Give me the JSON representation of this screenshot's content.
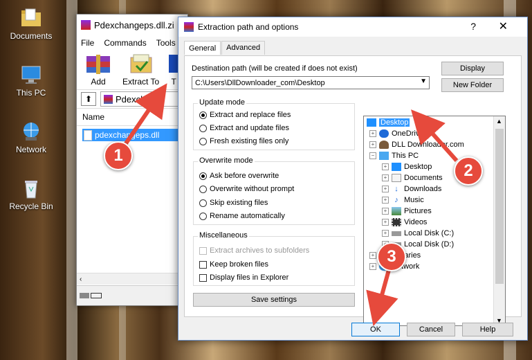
{
  "desktop": {
    "icons": [
      {
        "label": "Documents"
      },
      {
        "label": "This PC"
      },
      {
        "label": "Network"
      },
      {
        "label": "Recycle Bin"
      }
    ]
  },
  "winrar": {
    "title": "Pdexchangeps.dll.zi",
    "menu": [
      "File",
      "Commands",
      "Tools"
    ],
    "toolbar": {
      "add": "Add",
      "extract_to": "Extract To",
      "t": "T"
    },
    "address": "Pdexchang",
    "column_name": "Name",
    "file": "pdexchangeps.dll"
  },
  "dialog": {
    "title": "Extraction path and options",
    "help_glyph": "?",
    "close_glyph": "✕",
    "tabs": [
      "General",
      "Advanced"
    ],
    "dest_label": "Destination path (will be created if does not exist)",
    "dest_value": "C:\\Users\\DllDownloader_com\\Desktop",
    "display_button": "Display",
    "new_folder_button": "New Folder",
    "update_mode": {
      "title": "Update mode",
      "options": [
        "Extract and replace files",
        "Extract and update files",
        "Fresh existing files only"
      ]
    },
    "overwrite_mode": {
      "title": "Overwrite mode",
      "options": [
        "Ask before overwrite",
        "Overwrite without prompt",
        "Skip existing files",
        "Rename automatically"
      ]
    },
    "misc": {
      "title": "Miscellaneous",
      "options": [
        "Extract archives to subfolders",
        "Keep broken files",
        "Display files in Explorer"
      ]
    },
    "save_settings": "Save settings",
    "tree": [
      "Desktop",
      "OneDrive",
      "DLL Downloader.com",
      "This PC",
      "Desktop",
      "Documents",
      "Downloads",
      "Music",
      "Pictures",
      "Videos",
      "Local Disk (C:)",
      "Local Disk (D:)",
      "Libraries",
      "Network"
    ],
    "ok": "OK",
    "cancel": "Cancel",
    "help": "Help"
  },
  "callouts": [
    "1",
    "2",
    "3"
  ],
  "colors": {
    "selection": "#3399ff",
    "callout": "#e64a3c",
    "dialog_bg": "#f0f0f0"
  }
}
